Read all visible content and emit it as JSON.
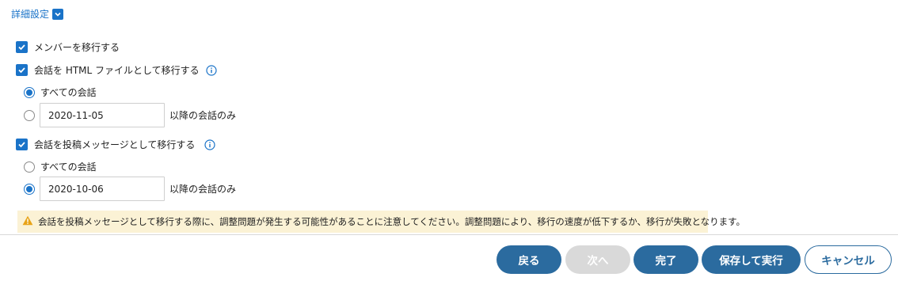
{
  "advanced": {
    "title": "詳細設定",
    "icon": "chevron-down-icon"
  },
  "options": {
    "migrate_members": {
      "label": "メンバーを移行する",
      "checked": true
    },
    "html_export": {
      "label": "会話を HTML ファイルとして移行する",
      "checked": true,
      "info_icon": "info-icon",
      "radio_all": {
        "label": "すべての会話",
        "selected": true
      },
      "radio_since": {
        "date": "2020-11-05",
        "suffix": "以降の会話のみ",
        "selected": false
      }
    },
    "post_messages": {
      "label": "会話を投稿メッセージとして移行する",
      "checked": true,
      "info_icon": "info-icon",
      "radio_all": {
        "label": "すべての会話",
        "selected": false
      },
      "radio_since": {
        "date": "2020-10-06",
        "suffix": "以降の会話のみ",
        "selected": true
      }
    }
  },
  "warning": {
    "icon": "warning-icon",
    "text": "会話を投稿メッセージとして移行する際に、調整問題が発生する可能性があることに注意してください。調整問題により、移行の速度が低下するか、移行が失敗となります。"
  },
  "buttons": {
    "back": "戻る",
    "next": "次へ",
    "finish": "完了",
    "save_run": "保存して実行",
    "cancel": "キャンセル"
  },
  "colors": {
    "accent": "#1a73c8",
    "button_primary": "#2b6b9f",
    "button_disabled": "#d9d9d9",
    "warning_bg": "#fbf2d5",
    "warning_icon": "#e8a317"
  }
}
